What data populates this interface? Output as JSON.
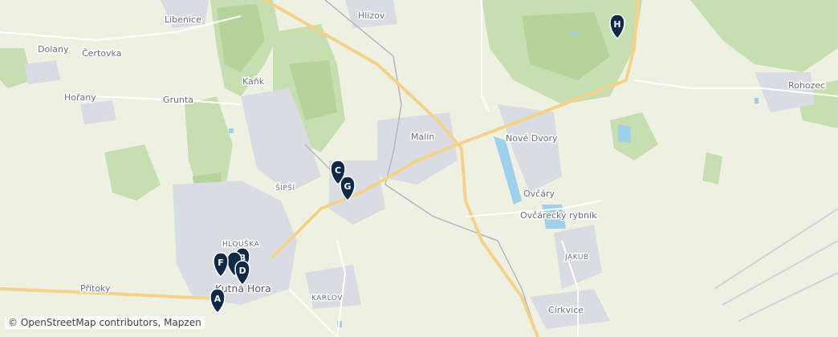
{
  "map": {
    "places": [
      {
        "key": "libenice",
        "name": "Libenice"
      },
      {
        "key": "hlizov",
        "name": "Hlízov"
      },
      {
        "key": "dolany",
        "name": "Dolany"
      },
      {
        "key": "certovka",
        "name": "Čertovka"
      },
      {
        "key": "kank",
        "name": "Kaňk"
      },
      {
        "key": "horany",
        "name": "Hořany"
      },
      {
        "key": "grunta",
        "name": "Grunta"
      },
      {
        "key": "rohozec",
        "name": "Rohozec"
      },
      {
        "key": "malin",
        "name": "Malín"
      },
      {
        "key": "nove_dvory",
        "name": "Nové Dvory"
      },
      {
        "key": "sipsi",
        "name": "ŠIPŠÍ"
      },
      {
        "key": "ovcary",
        "name": "Ovčáry"
      },
      {
        "key": "ovcarecky",
        "name": "Ovčárecký rybník"
      },
      {
        "key": "hlouska",
        "name": "HLOUŠKA"
      },
      {
        "key": "pritoky",
        "name": "Přítoky"
      },
      {
        "key": "jakub",
        "name": "JAKUB"
      },
      {
        "key": "kutna_hora",
        "name": "Kutná Hora"
      },
      {
        "key": "karlov",
        "name": "KARLOV"
      },
      {
        "key": "cirkvice",
        "name": "Církvice"
      }
    ],
    "markers": [
      "A",
      "B",
      "C",
      "D",
      "F",
      "G",
      "H"
    ],
    "attribution": "© OpenStreetMap contributors, Mapzen"
  }
}
